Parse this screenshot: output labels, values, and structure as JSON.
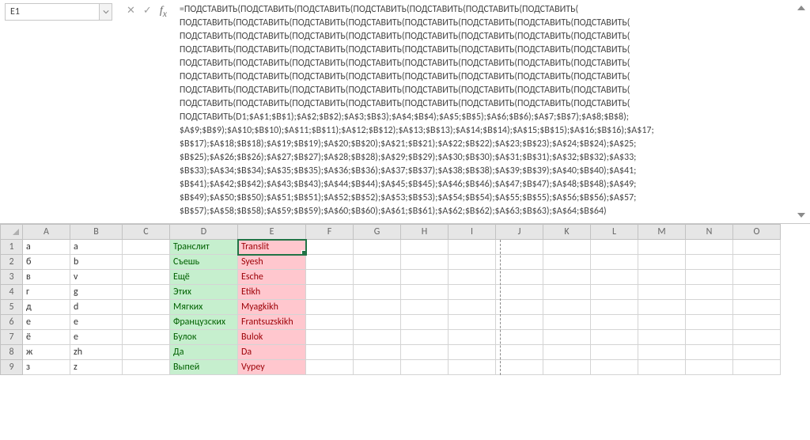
{
  "cellRef": "E1",
  "formula": "=ПОДСТАВИТЬ(ПОДСТАВИТЬ(ПОДСТАВИТЬ(ПОДСТАВИТЬ(ПОДСТАВИТЬ(ПОДСТАВИТЬ(ПОДСТАВИТЬ(\nПОДСТАВИТЬ(ПОДСТАВИТЬ(ПОДСТАВИТЬ(ПОДСТАВИТЬ(ПОДСТАВИТЬ(ПОДСТАВИТЬ(ПОДСТАВИТЬ(ПОДСТАВИТЬ(\nПОДСТАВИТЬ(ПОДСТАВИТЬ(ПОДСТАВИТЬ(ПОДСТАВИТЬ(ПОДСТАВИТЬ(ПОДСТАВИТЬ(ПОДСТАВИТЬ(ПОДСТАВИТЬ(\nПОДСТАВИТЬ(ПОДСТАВИТЬ(ПОДСТАВИТЬ(ПОДСТАВИТЬ(ПОДСТАВИТЬ(ПОДСТАВИТЬ(ПОДСТАВИТЬ(ПОДСТАВИТЬ(\nПОДСТАВИТЬ(ПОДСТАВИТЬ(ПОДСТАВИТЬ(ПОДСТАВИТЬ(ПОДСТАВИТЬ(ПОДСТАВИТЬ(ПОДСТАВИТЬ(ПОДСТАВИТЬ(\nПОДСТАВИТЬ(ПОДСТАВИТЬ(ПОДСТАВИТЬ(ПОДСТАВИТЬ(ПОДСТАВИТЬ(ПОДСТАВИТЬ(ПОДСТАВИТЬ(ПОДСТАВИТЬ(\nПОДСТАВИТЬ(ПОДСТАВИТЬ(ПОДСТАВИТЬ(ПОДСТАВИТЬ(ПОДСТАВИТЬ(ПОДСТАВИТЬ(ПОДСТАВИТЬ(ПОДСТАВИТЬ(\nПОДСТАВИТЬ(ПОДСТАВИТЬ(ПОДСТАВИТЬ(ПОДСТАВИТЬ(ПОДСТАВИТЬ(ПОДСТАВИТЬ(ПОДСТАВИТЬ(ПОДСТАВИТЬ(\nПОДСТАВИТЬ(D1;$A$1;$B$1);$A$2;$B$2);$A$3;$B$3);$A$4;$B$4);$A$5;$B$5);$A$6;$B$6);$A$7;$B$7);$A$8;$B$8);\n$A$9;$B$9);$A$10;$B$10);$A$11;$B$11);$A$12;$B$12);$A$13;$B$13);$A$14;$B$14);$A$15;$B$15);$A$16;$B$16);$A$17;\n$B$17);$A$18;$B$18);$A$19;$B$19);$A$20;$B$20);$A$21;$B$21);$A$22;$B$22);$A$23;$B$23);$A$24;$B$24);$A$25;\n$B$25);$A$26;$B$26);$A$27;$B$27);$A$28;$B$28);$A$29;$B$29);$A$30;$B$30);$A$31;$B$31);$A$32;$B$32);$A$33;\n$B$33);$A$34;$B$34);$A$35;$B$35);$A$36;$B$36);$A$37;$B$37);$A$38;$B$38);$A$39;$B$39);$A$40;$B$40);$A$41;\n$B$41);$A$42;$B$42);$A$43;$B$43);$A$44;$B$44);$A$45;$B$45);$A$46;$B$46);$A$47;$B$47);$A$48;$B$48);$A$49;\n$B$49);$A$50;$B$50);$A$51;$B$51);$A$52;$B$52);$A$53;$B$53);$A$54;$B$54);$A$55;$B$55);$A$56;$B$56);$A$57;\n$B$57);$A$58;$B$58);$A$59;$B$59);$A$60;$B$60);$A$61;$B$61);$A$62;$B$62);$A$63;$B$63);$A$64;$B$64)",
  "columns": [
    "A",
    "B",
    "C",
    "D",
    "E",
    "F",
    "G",
    "H",
    "I",
    "J",
    "K",
    "L",
    "M",
    "N",
    "O"
  ],
  "rows": [
    {
      "n": "1",
      "A": "а",
      "B": "a",
      "D": "Транслит",
      "E": "Translit",
      "active": "E"
    },
    {
      "n": "2",
      "A": "б",
      "B": "b",
      "D": "Съешь",
      "E": "Syesh"
    },
    {
      "n": "3",
      "A": "в",
      "B": "v",
      "D": "Ещё",
      "E": "Esche"
    },
    {
      "n": "4",
      "A": "г",
      "B": "g",
      "D": "Этих",
      "E": "Etikh"
    },
    {
      "n": "5",
      "A": "д",
      "B": "d",
      "D": "Мягких",
      "E": "Myagkikh"
    },
    {
      "n": "6",
      "A": "е",
      "B": "e",
      "D": "Французских",
      "E": "Frantsuzskikh"
    },
    {
      "n": "7",
      "A": "ё",
      "B": "e",
      "D": "Булок",
      "E": "Bulok"
    },
    {
      "n": "8",
      "A": "ж",
      "B": "zh",
      "D": "Да",
      "E": "Da"
    },
    {
      "n": "9",
      "A": "з",
      "B": "z",
      "D": "Выпей",
      "E": "Vypey"
    }
  ]
}
